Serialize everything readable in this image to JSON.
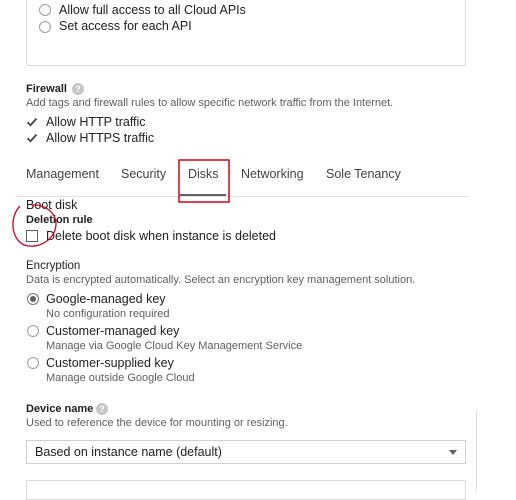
{
  "access": {
    "options": [
      {
        "label": "Allow full access to all Cloud APIs"
      },
      {
        "label": "Set access for each API"
      }
    ]
  },
  "firewall": {
    "title": "Firewall",
    "help_icon": "help-icon",
    "description": "Add tags and firewall rules to allow specific network traffic from the Internet.",
    "options": [
      {
        "label": "Allow HTTP traffic",
        "checked": true
      },
      {
        "label": "Allow HTTPS traffic",
        "checked": true
      }
    ]
  },
  "tabs": [
    {
      "label": "Management"
    },
    {
      "label": "Security"
    },
    {
      "label": "Disks",
      "selected": true
    },
    {
      "label": "Networking"
    },
    {
      "label": "Sole Tenancy"
    }
  ],
  "boot_disk": {
    "title": "Boot disk",
    "deletion_rule": {
      "title": "Deletion rule",
      "checkbox_label": "Delete boot disk when instance is deleted",
      "checked": false
    }
  },
  "encryption": {
    "title": "Encryption",
    "description": "Data is encrypted automatically. Select an encryption key management solution.",
    "options": [
      {
        "label": "Google-managed key",
        "sub": "No configuration required",
        "selected": true
      },
      {
        "label": "Customer-managed key",
        "sub": "Manage via Google Cloud Key Management Service",
        "selected": false
      },
      {
        "label": "Customer-supplied key",
        "sub": "Manage outside Google Cloud",
        "selected": false
      }
    ]
  },
  "device_name": {
    "title": "Device name",
    "description": "Used to reference the device for mounting or resizing.",
    "selected": "Based on instance name (default)"
  },
  "colors": {
    "annotation": "#d0021b",
    "checkbox": "#424242"
  }
}
